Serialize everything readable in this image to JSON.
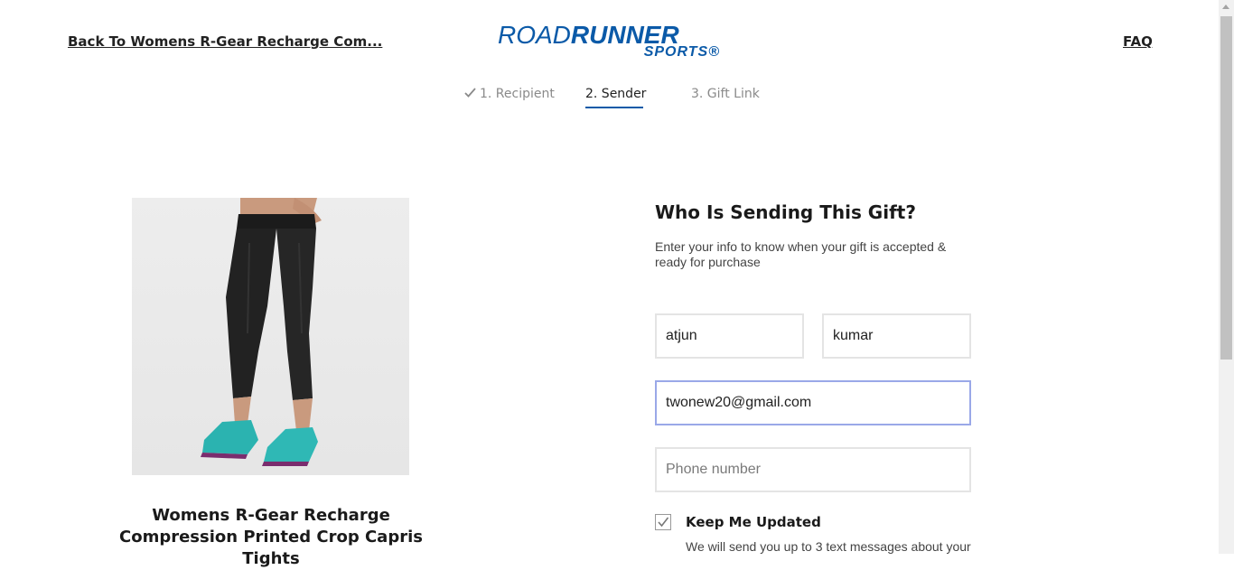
{
  "header": {
    "back_label": "Back To Womens R-Gear Recharge Com...",
    "faq_label": "FAQ",
    "logo_road": "ROAD",
    "logo_runner": "RUNNER",
    "logo_sports": "SPORTS®"
  },
  "steps": [
    {
      "label": "1. Recipient",
      "state": "completed"
    },
    {
      "label": "2. Sender",
      "state": "active"
    },
    {
      "label": "3. Gift Link",
      "state": "upcoming"
    }
  ],
  "product": {
    "title": "Womens R-Gear Recharge Compression Printed Crop Capris Tights"
  },
  "form": {
    "heading": "Who Is Sending This Gift?",
    "subheading": "Enter your info to know when your gift is accepted & ready for purchase",
    "first_name": "atjun",
    "last_name": "kumar",
    "email": "twonew20@gmail.com",
    "phone_placeholder": "Phone number",
    "keep_updated_label": "Keep Me Updated",
    "keep_updated_checked": true,
    "keep_updated_desc": "We will send you up to 3 text messages about your"
  },
  "colors": {
    "brand": "#0b5aa8",
    "email_focus_border": "#9aa8e8"
  }
}
